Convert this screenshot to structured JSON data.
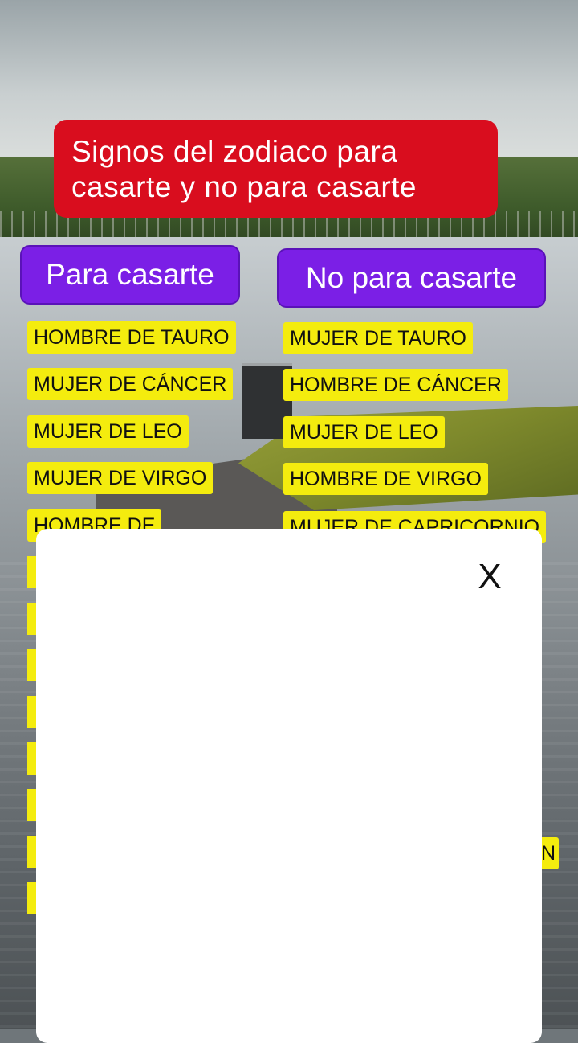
{
  "title": "Signos del zodiaco para casarte y no para casarte",
  "columns": {
    "left_header": "Para casarte",
    "right_header": "No para casarte"
  },
  "left_items": [
    "HOMBRE DE TAURO",
    "MUJER DE CÁNCER",
    "MUJER DE LEO",
    "MUJER DE VIRGO",
    "HOMBRE DE"
  ],
  "right_items": [
    "MUJER DE TAURO",
    "HOMBRE DE CÁNCER",
    "MUJER DE LEO",
    "HOMBRE DE VIRGO",
    "MUJER DE CAPRICORNIO",
    "N"
  ],
  "modal": {
    "close_label": "X"
  },
  "colors": {
    "title_bg": "#d90d1e",
    "header_bg": "#7b1fe6",
    "tag_bg": "#f4ec0e",
    "modal_bg": "#ffffff"
  }
}
